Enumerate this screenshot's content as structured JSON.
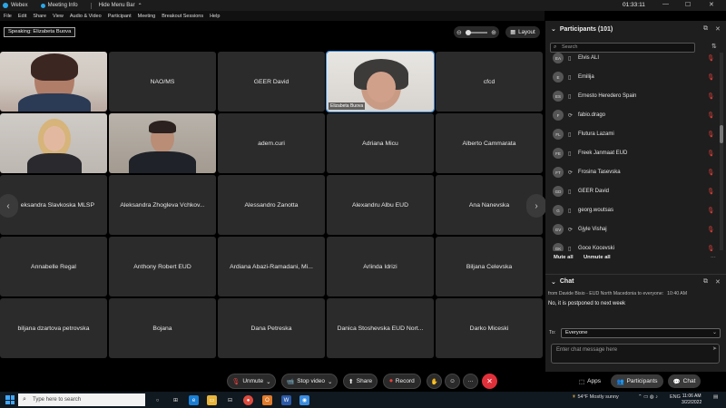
{
  "window": {
    "app_name": "Webex",
    "menu_info": "Meeting Info",
    "hide_menu": "Hide Menu Bar",
    "timer": "01:33:11"
  },
  "menu": [
    "File",
    "Edit",
    "Share",
    "View",
    "Audio & Video",
    "Participant",
    "Meeting",
    "Breakout Sessions",
    "Help"
  ],
  "toolbar": {
    "speaking": "Speaking: Elizabeta Buova",
    "layout_label": "Layout"
  },
  "tiles": [
    {
      "label": "",
      "video": true
    },
    {
      "label": "NAO/MS",
      "video": false
    },
    {
      "label": "GEER David",
      "video": false
    },
    {
      "label": "Elizabeta Buova",
      "video": true
    },
    {
      "label": "cfcd",
      "video": false
    },
    {
      "label": "",
      "video": true
    },
    {
      "label": "",
      "video": true
    },
    {
      "label": "adem.curi",
      "video": false
    },
    {
      "label": "Adriana Micu",
      "video": false
    },
    {
      "label": "Alberto Cammarata",
      "video": false
    },
    {
      "label": "eksandra Slavkoska MLSP",
      "video": false
    },
    {
      "label": "Aleksandra Zhogleva Vchkov...",
      "video": false
    },
    {
      "label": "Alessandro Zanotta",
      "video": false
    },
    {
      "label": "Alexandru Albu EUD",
      "video": false
    },
    {
      "label": "Ana Nanevska",
      "video": false
    },
    {
      "label": "Annabelle Regal",
      "video": false
    },
    {
      "label": "Anthony Robert EUD",
      "video": false
    },
    {
      "label": "Ardiana Abazi-Ramadani, Mi...",
      "video": false
    },
    {
      "label": "Arlinda Idrizi",
      "video": false
    },
    {
      "label": "Biljana Celevska",
      "video": false
    },
    {
      "label": "biljana dzartova petrovska",
      "video": false
    },
    {
      "label": "Bojana",
      "video": false
    },
    {
      "label": "Dana Petreska",
      "video": false
    },
    {
      "label": "Danica Stoshevska EUD Nort...",
      "video": false
    },
    {
      "label": "Darko Miceski",
      "video": false
    }
  ],
  "controls": {
    "unmute": "Unmute",
    "stop_video": "Stop video",
    "share": "Share",
    "record": "Record",
    "more": "···",
    "apps": "Apps",
    "participants": "Participants",
    "chat": "Chat"
  },
  "participants_panel": {
    "title": "Participants (101)",
    "search_placeholder": "Search",
    "items": [
      {
        "initials": "EA",
        "name": "Elvis ALI"
      },
      {
        "initials": "E",
        "name": "Emilija"
      },
      {
        "initials": "ES",
        "name": "Ernesto Heredero Spain"
      },
      {
        "initials": "F",
        "name": "fabio.drago"
      },
      {
        "initials": "FL",
        "name": "Flutura Lazami"
      },
      {
        "initials": "FE",
        "name": "Freek Janmaat EUD"
      },
      {
        "initials": "FT",
        "name": "Frosina Tasevska"
      },
      {
        "initials": "GD",
        "name": "GEER David"
      },
      {
        "initials": "G",
        "name": "georg.woutsas"
      },
      {
        "initials": "GV",
        "name": "Gjyle Vishaj"
      },
      {
        "initials": "GK",
        "name": "Goce Kocevski"
      }
    ],
    "mute_all": "Mute all",
    "unmute_all": "Unmute all"
  },
  "chat_panel": {
    "title": "Chat",
    "from": "from Davide Bisio - EUD North Macedonia to everyone:",
    "time": "10:40 AM",
    "message": "No, it is postponed to next week",
    "to_label": "To:",
    "to_value": "Everyone",
    "input_placeholder": "Enter chat message here"
  },
  "taskbar": {
    "search_placeholder": "Type here to search",
    "weather": "54°F  Mostly sunny",
    "lang": "ENG",
    "time": "11:06 AM",
    "date": "3/22/2022"
  },
  "colors": {
    "accent": "#2aa7e8",
    "mute_red": "#e8413b",
    "end_red": "#e0313b"
  }
}
